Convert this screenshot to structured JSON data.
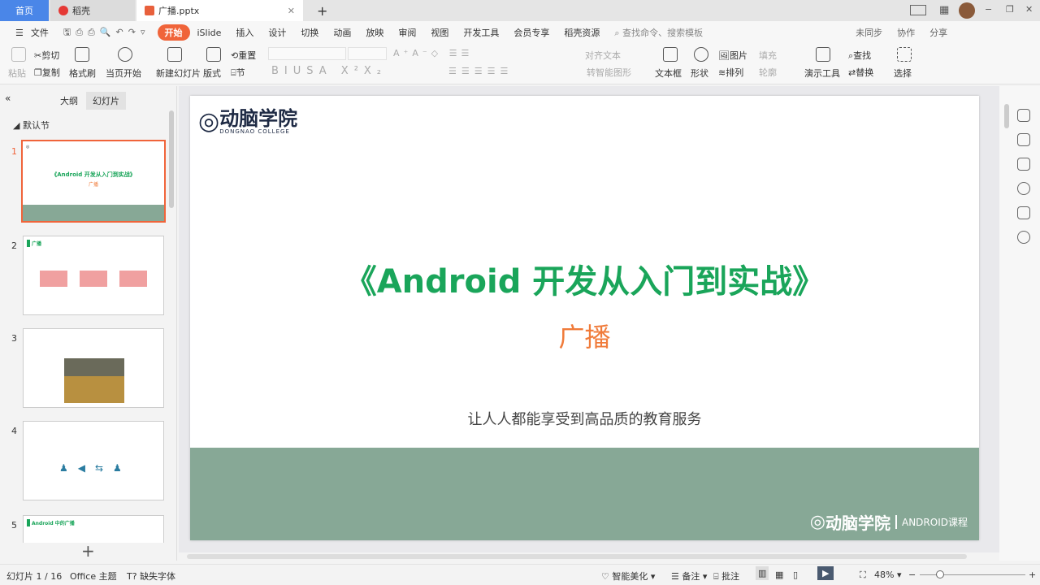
{
  "tabs": {
    "home": "首页",
    "daoke": "稻壳",
    "file": "广播.pptx",
    "new_tab": "+"
  },
  "window": {
    "minimize": "−",
    "restore": "❐",
    "close": "✕"
  },
  "menu": {
    "file": "文件",
    "items": [
      "开始",
      "iSlide",
      "插入",
      "设计",
      "切换",
      "动画",
      "放映",
      "审阅",
      "视图",
      "开发工具",
      "会员专享",
      "稻壳资源"
    ],
    "search_placeholder": "查找命令、搜索模板",
    "sync": "未同步",
    "collab": "协作",
    "share": "分享"
  },
  "ribbon": {
    "paste": "粘贴",
    "cut": "剪切",
    "copy": "复制",
    "format_painter": "格式刷",
    "play_current": "当页开始",
    "new_slide": "新建幻灯片",
    "layout": "版式",
    "reset": "重置",
    "section": "节",
    "align_text": "对齐文本",
    "smartart": "转智能图形",
    "textbox": "文本框",
    "shape": "形状",
    "picture": "图片",
    "fill": "填充",
    "arrange": "排列",
    "outline": "轮廓",
    "present_tools": "演示工具",
    "find": "查找",
    "replace": "替换",
    "select": "选择"
  },
  "panel": {
    "outline_tab": "大纲",
    "slides_tab": "幻灯片",
    "section": "默认节",
    "add": "+"
  },
  "thumbnails": [
    {
      "num": "1",
      "title": "《Android 开发从入门到实战》",
      "sub": "广播"
    },
    {
      "num": "2",
      "title": "广播"
    },
    {
      "num": "3",
      "title": ""
    },
    {
      "num": "4",
      "title": ""
    },
    {
      "num": "5",
      "title": "Android 中的广播"
    }
  ],
  "slide": {
    "logo": "动脑学院",
    "logo_en": "DONGNAO COLLEGE",
    "title": "《Android 开发从入门到实战》",
    "subtitle": "广播",
    "tagline": "让人人都能享受到高品质的教育服务",
    "footer_logo": "动脑学院",
    "footer_course": "ANDROID课程",
    "title_color": "#1aa55a",
    "subtitle_color": "#f07b3a",
    "band_color": "#87a896"
  },
  "status": {
    "slide_count": "幻灯片 1 / 16",
    "theme": "Office 主题",
    "missing_font": "缺失字体",
    "beautify": "智能美化",
    "notes": "备注",
    "comment": "批注",
    "zoom": "48%",
    "zoom_level": 0.48
  }
}
